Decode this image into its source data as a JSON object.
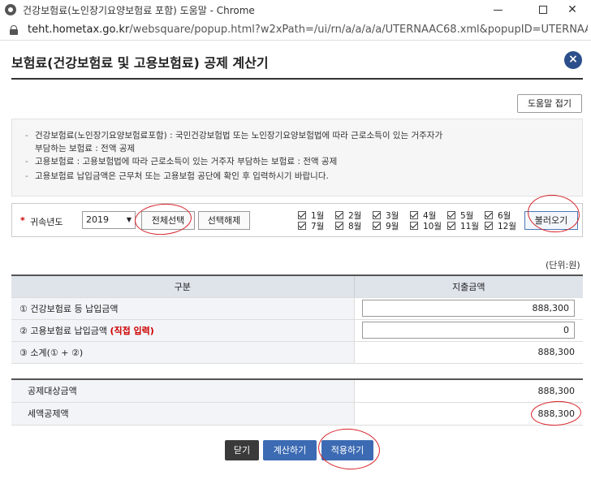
{
  "browser": {
    "window_title": "건강보험료(노인장기요양보험료 포함) 도움말 - Chrome",
    "url_host": "teht.hometax.go.kr",
    "url_path": "/websquare/popup.html?w2xPath=/ui/rn/a/a/a/a/UTERNAAC68.xml&popupID=UTERNAAC68&w2..."
  },
  "popup": {
    "title": "보험료(건강보험료 및 고용보험료) 공제 계산기",
    "close_label": "×",
    "help_button": "도움말 접기"
  },
  "info": {
    "line1": "건강보험료(노인장기요양보험료포함) : 국민건강보험법 또는 노인장기요양보험법에 따라 근로소득이 있는 거주자가",
    "line1b": "부담하는 보험료 : 전액 공제",
    "line2": "고용보험료 : 고용보험법에 따라 근로소득이 있는 거주자 부담하는 보험료 : 전액 공제",
    "line3": "고용보험료 납입금액은 근무처 또는 고용보험 공단에 확인 후 입력하시기 바랍니다."
  },
  "year_filter": {
    "required_mark": "*",
    "label": "귀속년도",
    "selected_year": "2019",
    "select_all": "전체선택",
    "deselect_all": "선택해제",
    "months": [
      "1월",
      "2월",
      "3월",
      "4월",
      "5월",
      "6월",
      "7월",
      "8월",
      "9월",
      "10월",
      "11월",
      "12월"
    ],
    "load_button": "불러오기"
  },
  "unit": "(단위:원)",
  "table": {
    "headers": [
      "구분",
      "지출금액"
    ],
    "row1_label": "① 건강보험료 등 납입금액",
    "row1_value": "888,300",
    "row2_label": "② 고용보험료 납입금액 ",
    "row2_note": "(직접 입력)",
    "row2_value": "0",
    "row3_label": "③ 소계(① + ②)",
    "row3_value": "888,300"
  },
  "result": {
    "target_label": "공제대상금액",
    "target_value": "888,300",
    "credit_label": "세액공제액",
    "credit_value": "888,300"
  },
  "buttons": {
    "close": "닫기",
    "calculate": "계산하기",
    "apply": "적용하기"
  },
  "colors": {
    "primary_blue": "#3c6bb3",
    "dark_button": "#3a3a3a",
    "required_red": "#cc0000",
    "annotation_red": "#d8232a"
  }
}
